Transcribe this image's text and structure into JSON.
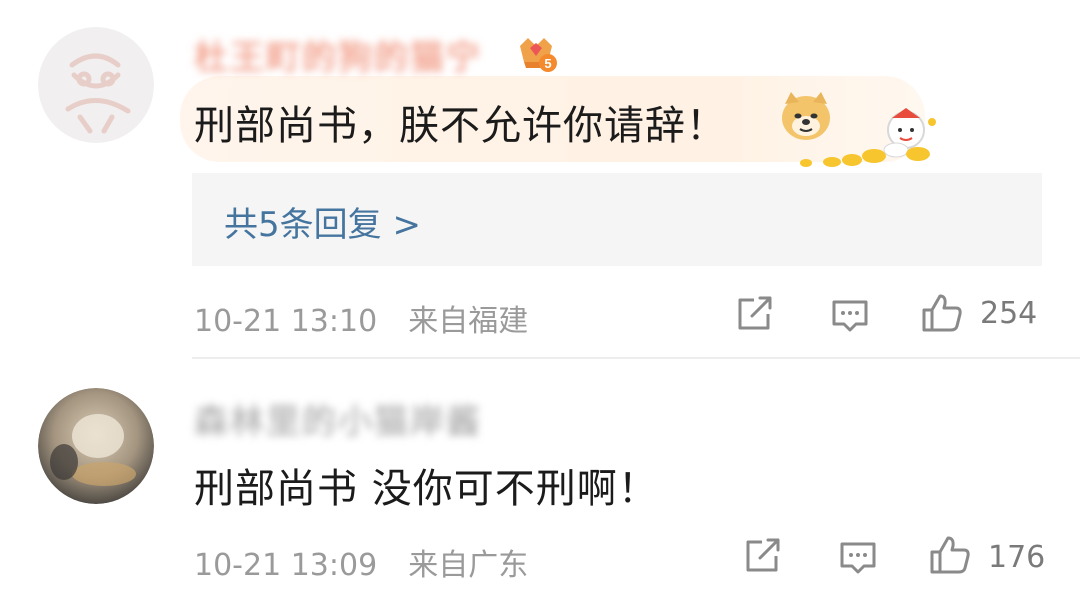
{
  "comments": [
    {
      "username": "杜王町的狗的猫宁",
      "text": "刑部尚书，朕不允许你请辞！",
      "emoji": "doge-emoji",
      "replies_label": "共5条回复 >",
      "time": "10-21 13:10",
      "location": "来自福建",
      "likes": "254",
      "badge_level": "5"
    },
    {
      "username": "森林里的小猫岸酱",
      "text": "刑部尚书 没你可不刑啊！",
      "time": "10-21 13:09",
      "location": "来自广东",
      "likes": "176"
    }
  ],
  "colors": {
    "reply_link": "#45759f",
    "meta_gray": "#9a9a9a",
    "username_orange": "#f3a38f",
    "username_gray": "#b8b8b8",
    "highlight": "#fff3e7"
  }
}
